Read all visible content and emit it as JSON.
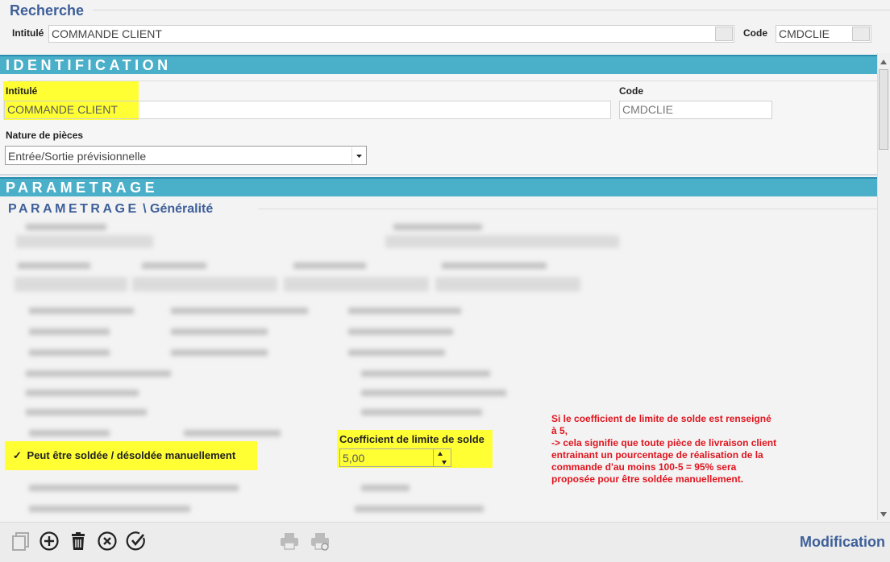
{
  "search": {
    "title": "Recherche",
    "intitule_label": "Intitulé",
    "intitule_value": "COMMANDE CLIENT",
    "code_label": "Code",
    "code_value": "CMDCLIE"
  },
  "identification": {
    "header": "IDENTIFICATION",
    "intitule_label": "Intitulé",
    "intitule_value": "COMMANDE CLIENT",
    "code_label": "Code",
    "code_value": "CMDCLIE",
    "nature_label": "Nature de pièces",
    "nature_value": "Entrée/Sortie prévisionnelle"
  },
  "parametrage": {
    "header": "PARAMETRAGE",
    "sub_main": "PARAMETRAGE",
    "sub_sep": " \\ ",
    "sub_part": "Généralité",
    "solde_checkbox_mark": "✓",
    "solde_checkbox_label": "Peut être soldée / désoldée manuellement",
    "coef_label": "Coefficient de limite de solde",
    "coef_value": "5,00"
  },
  "note": {
    "line1": "Si le coefficient de limite de solde est renseigné",
    "line2": "à 5,",
    "line3": "-> cela signifie que toute pièce de livraison client",
    "line4": "entrainant un pourcentage de réalisation de la",
    "line5": "commande d'au moins 100-5 = 95% sera",
    "line6": "proposée pour être soldée manuellement."
  },
  "status": {
    "mode": "Modification"
  },
  "colors": {
    "accent": "#4aafc9",
    "title": "#3e5f9a",
    "highlight": "#ffff33",
    "note": "#e0141e"
  }
}
